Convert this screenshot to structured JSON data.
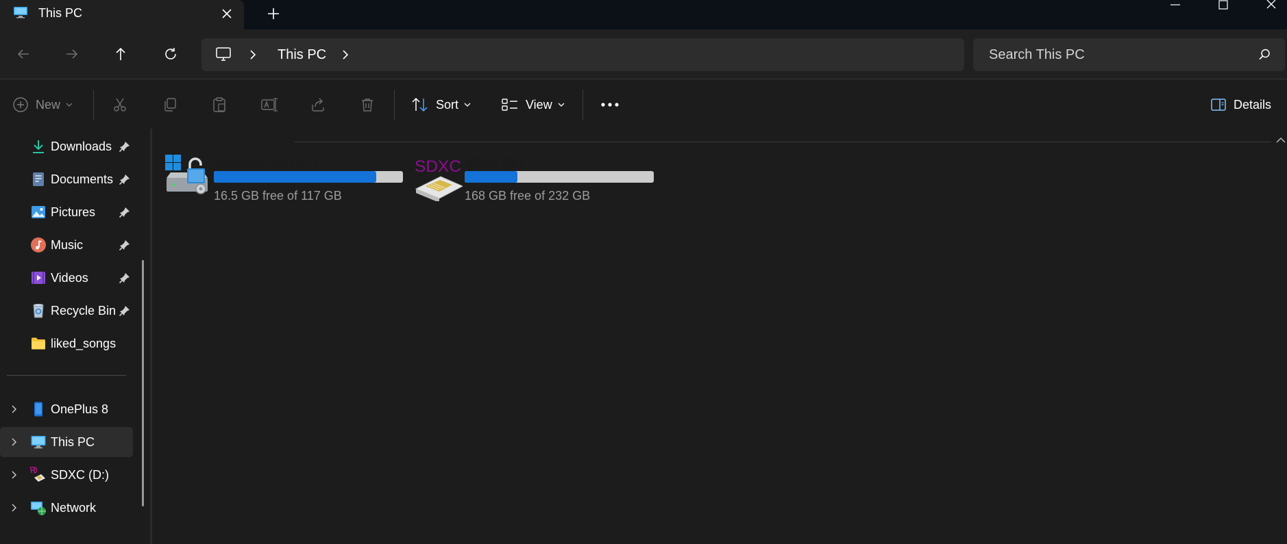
{
  "window": {
    "tab_title": "This PC",
    "new_tab_symbol": "+"
  },
  "nav": {
    "crumb": "This PC",
    "search_placeholder": "Search This PC"
  },
  "toolbar": {
    "new_label": "New",
    "sort_label": "Sort",
    "view_label": "View",
    "details_label": "Details"
  },
  "sidebar": {
    "quick_access": [
      {
        "label": "Downloads",
        "icon": "download-icon",
        "pinned": true
      },
      {
        "label": "Documents",
        "icon": "documents-icon",
        "pinned": true
      },
      {
        "label": "Pictures",
        "icon": "pictures-icon",
        "pinned": true
      },
      {
        "label": "Music",
        "icon": "music-icon",
        "pinned": true
      },
      {
        "label": "Videos",
        "icon": "videos-icon",
        "pinned": true
      },
      {
        "label": "Recycle Bin",
        "icon": "recycle-bin-icon",
        "pinned": true
      },
      {
        "label": "liked_songs",
        "icon": "folder-icon",
        "pinned": false
      }
    ],
    "locations": [
      {
        "label": "OnePlus 8",
        "icon": "phone-icon"
      },
      {
        "label": "This PC",
        "icon": "computer-icon",
        "selected": true
      },
      {
        "label": "SDXC (D:)",
        "icon": "sd-card-icon"
      },
      {
        "label": "Network",
        "icon": "network-icon"
      }
    ]
  },
  "drives": [
    {
      "name": "Windows-SSD (C:)",
      "free_text": "16.5 GB free of 117 GB",
      "used_fraction": 0.86,
      "icon": "windows-drive-icon"
    },
    {
      "name": "SDXC (D:)",
      "free_text": "168 GB free of 232 GB",
      "used_fraction": 0.28,
      "icon": "sdxc-drive-icon",
      "badge": "SDXC"
    }
  ],
  "colors": {
    "accent": "#1473d8",
    "bar_track": "#cccccc",
    "sdxc_badge": "#8b0f8f"
  }
}
